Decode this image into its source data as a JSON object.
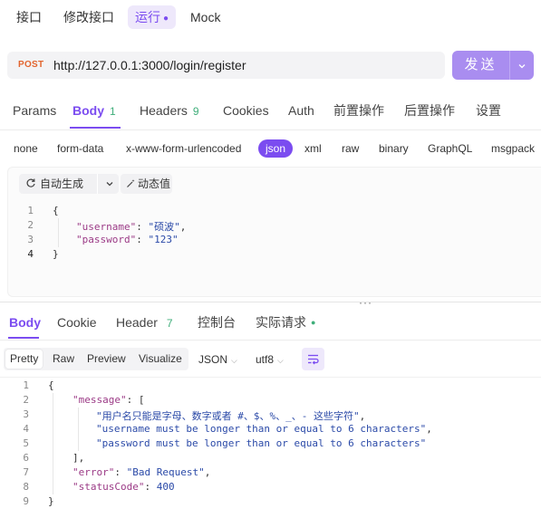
{
  "top_tabs": [
    "接口",
    "修改接口",
    "运行",
    "Mock"
  ],
  "request": {
    "method": "POST",
    "url": "http://127.0.0.1:3000/login/register",
    "send_label": "发送",
    "send_chevron": "⌄"
  },
  "request_tabs": {
    "params": "Params",
    "body": "Body",
    "body_count": "1",
    "headers": "Headers",
    "headers_count": "9",
    "cookies": "Cookies",
    "auth": "Auth",
    "pre": "前置操作",
    "post": "后置操作",
    "settings": "设置"
  },
  "body_types": [
    "none",
    "form-data",
    "x-www-form-urlencoded",
    "json",
    "xml",
    "raw",
    "binary",
    "GraphQL",
    "msgpack"
  ],
  "body_editor": {
    "auto_generate": "自动生成",
    "dynamic_value": "动态值",
    "line_numbers": [
      "1",
      "2",
      "3",
      "4"
    ],
    "brace_open": "{",
    "brace_close": "}",
    "username_key": "\"username\"",
    "username_value": "\"硕波\"",
    "password_key": "\"password\"",
    "password_value": "\"123\""
  },
  "response_tabs": {
    "body": "Body",
    "cookie": "Cookie",
    "header": "Header",
    "header_count": "7",
    "console": "控制台",
    "actual_request": "实际请求"
  },
  "view_modes": [
    "Pretty",
    "Raw",
    "Preview",
    "Visualize"
  ],
  "format_select": "JSON",
  "encoding_select": "utf8",
  "response_body": {
    "line_numbers": [
      "1",
      "2",
      "3",
      "4",
      "5",
      "6",
      "7",
      "8",
      "9"
    ],
    "brace_open": "{",
    "message_key": "\"message\"",
    "messages": [
      "\"用户名只能是字母、数字或者 #、$、%、_、- 这些字符\"",
      "\"username must be longer than or equal to 6 characters\"",
      "\"password must be longer than or equal to 6 characters\""
    ],
    "array_close": "],",
    "error_key": "\"error\"",
    "error_value": "\"Bad Request\"",
    "status_key": "\"statusCode\"",
    "status_value": "400",
    "brace_close": "}"
  },
  "colors": {
    "accent": "#7b4cf0",
    "send_button": "#a98df0",
    "method": "#e2652f",
    "badge_green": "#3fae7a"
  }
}
